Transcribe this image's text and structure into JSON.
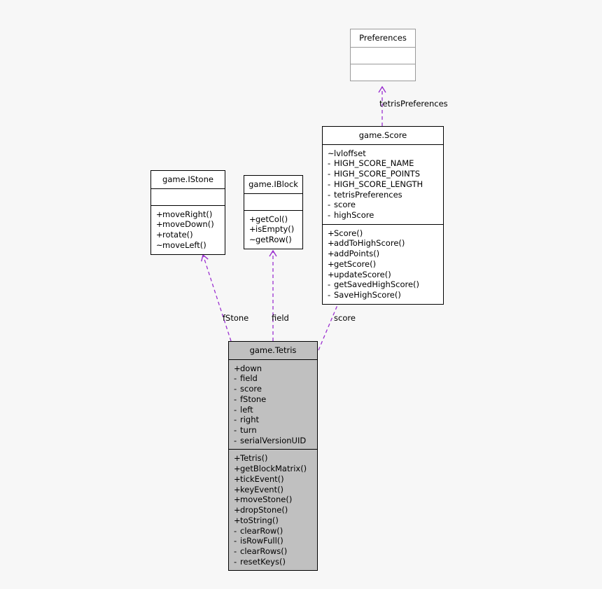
{
  "diagram": {
    "type": "uml-class-diagram",
    "background_color": "#f7f7f7",
    "edge_color": "#9b30d0",
    "highlight_fill": "#c0c0c0"
  },
  "classes": [
    {
      "id": "preferences",
      "name": "Preferences",
      "external": true,
      "highlight": false,
      "attributes": [],
      "methods": []
    },
    {
      "id": "score",
      "name": "game.Score",
      "external": false,
      "highlight": false,
      "attributes": [
        {
          "visibility": "~",
          "label": "lvloffset"
        },
        {
          "visibility": "-",
          "label": "HIGH_SCORE_NAME"
        },
        {
          "visibility": "-",
          "label": "HIGH_SCORE_POINTS"
        },
        {
          "visibility": "-",
          "label": "HIGH_SCORE_LENGTH"
        },
        {
          "visibility": "-",
          "label": "tetrisPreferences"
        },
        {
          "visibility": "-",
          "label": "score"
        },
        {
          "visibility": "-",
          "label": "highScore"
        }
      ],
      "methods": [
        {
          "visibility": "+",
          "label": "Score()"
        },
        {
          "visibility": "+",
          "label": "addToHighScore()"
        },
        {
          "visibility": "+",
          "label": "addPoints()"
        },
        {
          "visibility": "+",
          "label": "getScore()"
        },
        {
          "visibility": "+",
          "label": "updateScore()"
        },
        {
          "visibility": "-",
          "label": "getSavedHighScore()"
        },
        {
          "visibility": "-",
          "label": "SaveHighScore()"
        }
      ]
    },
    {
      "id": "istone",
      "name": "game.IStone",
      "external": false,
      "highlight": false,
      "attributes": [],
      "methods": [
        {
          "visibility": "+",
          "label": "moveRight()"
        },
        {
          "visibility": "+",
          "label": "moveDown()"
        },
        {
          "visibility": "+",
          "label": "rotate()"
        },
        {
          "visibility": "~",
          "label": "moveLeft()"
        }
      ]
    },
    {
      "id": "iblock",
      "name": "game.IBlock",
      "external": false,
      "highlight": false,
      "attributes": [],
      "methods": [
        {
          "visibility": "+",
          "label": "getCol()"
        },
        {
          "visibility": "+",
          "label": "isEmpty()"
        },
        {
          "visibility": "~",
          "label": "getRow()"
        }
      ]
    },
    {
      "id": "tetris",
      "name": "game.Tetris",
      "external": false,
      "highlight": true,
      "attributes": [
        {
          "visibility": "+",
          "label": "down"
        },
        {
          "visibility": "-",
          "label": "field"
        },
        {
          "visibility": "-",
          "label": "score"
        },
        {
          "visibility": "-",
          "label": "fStone"
        },
        {
          "visibility": "-",
          "label": "left"
        },
        {
          "visibility": "-",
          "label": "right"
        },
        {
          "visibility": "-",
          "label": "turn"
        },
        {
          "visibility": "-",
          "label": "serialVersionUID"
        }
      ],
      "methods": [
        {
          "visibility": "+",
          "label": "Tetris()"
        },
        {
          "visibility": "+",
          "label": "getBlockMatrix()"
        },
        {
          "visibility": "+",
          "label": "tickEvent()"
        },
        {
          "visibility": "+",
          "label": "keyEvent()"
        },
        {
          "visibility": "+",
          "label": "moveStone()"
        },
        {
          "visibility": "+",
          "label": "dropStone()"
        },
        {
          "visibility": "+",
          "label": "toString()"
        },
        {
          "visibility": "-",
          "label": "clearRow()"
        },
        {
          "visibility": "-",
          "label": "isRowFull()"
        },
        {
          "visibility": "-",
          "label": "clearRows()"
        },
        {
          "visibility": "-",
          "label": "resetKeys()"
        }
      ]
    }
  ],
  "edges": [
    {
      "id": "edge-tetris-prefs",
      "label": "tetrisPreferences",
      "from": "score",
      "to": "preferences"
    },
    {
      "id": "edge-fstone",
      "label": "fStone",
      "from": "tetris",
      "to": "istone"
    },
    {
      "id": "edge-field",
      "label": "field",
      "from": "tetris",
      "to": "iblock"
    },
    {
      "id": "edge-score",
      "label": "score",
      "from": "tetris",
      "to": "score"
    }
  ]
}
